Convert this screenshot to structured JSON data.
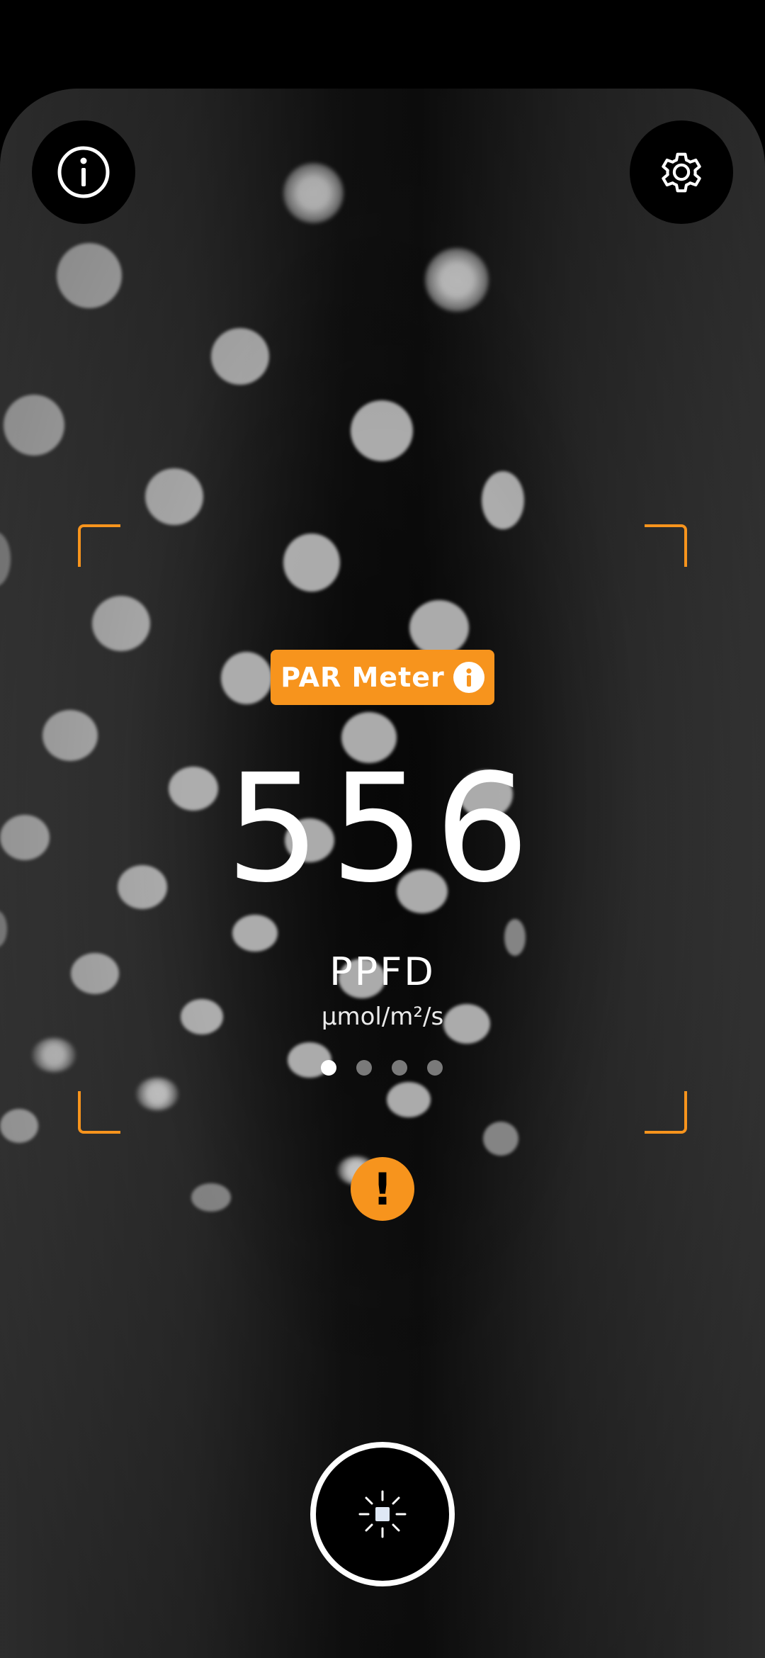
{
  "header": {
    "info_button": {
      "icon": "info-icon"
    },
    "settings_button": {
      "icon": "gear-icon"
    }
  },
  "meter": {
    "mode_label": "PAR Meter",
    "mode_info_icon": "info-icon",
    "reading": "556",
    "unit": "PPFD",
    "unit_detail": "μmol/m²/s",
    "page_count": 4,
    "active_page": 1
  },
  "warning": {
    "symbol": "!",
    "icon": "warning-icon"
  },
  "capture": {
    "icon": "light-sensor-icon"
  },
  "colors": {
    "accent": "#f7941d",
    "background": "#000000",
    "text": "#ffffff"
  }
}
